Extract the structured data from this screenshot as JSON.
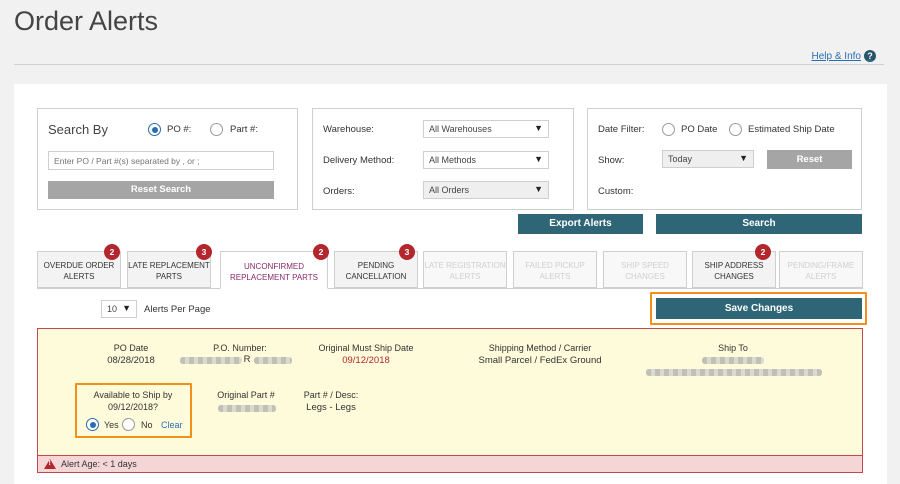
{
  "page": {
    "title": "Order Alerts",
    "help_label": "Help & Info",
    "help_icon": "?"
  },
  "search_by": {
    "label": "Search By",
    "options": [
      {
        "label": "PO #:",
        "selected": true
      },
      {
        "label": "Part #:",
        "selected": false
      }
    ],
    "input_placeholder": "Enter PO / Part #(s) separated by , or ;",
    "reset_label": "Reset Search"
  },
  "filters": {
    "warehouse_label": "Warehouse:",
    "warehouse_value": "All Warehouses",
    "delivery_label": "Delivery Method:",
    "delivery_value": "All Methods",
    "orders_label": "Orders:",
    "orders_value": "All Orders"
  },
  "date_filter": {
    "label": "Date Filter:",
    "options": [
      {
        "label": "PO Date",
        "selected": false
      },
      {
        "label": "Estimated Ship Date",
        "selected": false
      }
    ],
    "show_label": "Show:",
    "show_value": "Today",
    "reset_label": "Reset",
    "custom_label": "Custom:"
  },
  "actions": {
    "export_label": "Export Alerts",
    "search_label": "Search"
  },
  "tabs": [
    {
      "line1": "OVERDUE ORDER",
      "line2": "ALERTS",
      "badge": "2",
      "state": "normal"
    },
    {
      "line1": "LATE REPLACEMENT",
      "line2": "PARTS",
      "badge": "3",
      "state": "normal"
    },
    {
      "line1": "UNCONFIRMED",
      "line2": "REPLACEMENT PARTS",
      "badge": "2",
      "state": "active"
    },
    {
      "line1": "PENDING",
      "line2": "CANCELLATION",
      "badge": "3",
      "state": "normal"
    },
    {
      "line1": "LATE REGISTRATION",
      "line2": "ALERTS",
      "badge": "",
      "state": "disabled"
    },
    {
      "line1": "FAILED PICKUP",
      "line2": "ALERTS",
      "badge": "",
      "state": "disabled"
    },
    {
      "line1": "SHIP SPEED",
      "line2": "CHANGES",
      "badge": "",
      "state": "disabled"
    },
    {
      "line1": "SHIP ADDRESS",
      "line2": "CHANGES",
      "badge": "2",
      "state": "normal"
    },
    {
      "line1": "PENDING/FRAME",
      "line2": "ALERTS",
      "badge": "",
      "state": "disabled"
    }
  ],
  "pagination": {
    "per_page_value": "10",
    "per_page_label": "Alerts Per Page"
  },
  "save_label": "Save Changes",
  "alert": {
    "po_date_label": "PO Date",
    "po_date_value": "08/28/2018",
    "po_number_label": "P.O. Number:",
    "po_number_suffix": "R",
    "must_ship_label": "Original Must Ship Date",
    "must_ship_value": "09/12/2018",
    "shipping_label": "Shipping Method / Carrier",
    "shipping_value": "Small Parcel / FedEx Ground",
    "ship_to_label": "Ship To",
    "available_label": "Available to Ship by",
    "available_date": "09/12/2018?",
    "yes_label": "Yes",
    "no_label": "No",
    "clear_label": "Clear",
    "original_part_label": "Original Part #",
    "part_desc_label": "Part # / Desc:",
    "part_desc_value": "Legs - Legs",
    "age_label": "Alert Age: < 1 days"
  },
  "colors": {
    "teal": "#2e6677",
    "badge_red": "#b3262d",
    "highlight": "#f0901b",
    "card_bg": "#fdfbd9"
  }
}
